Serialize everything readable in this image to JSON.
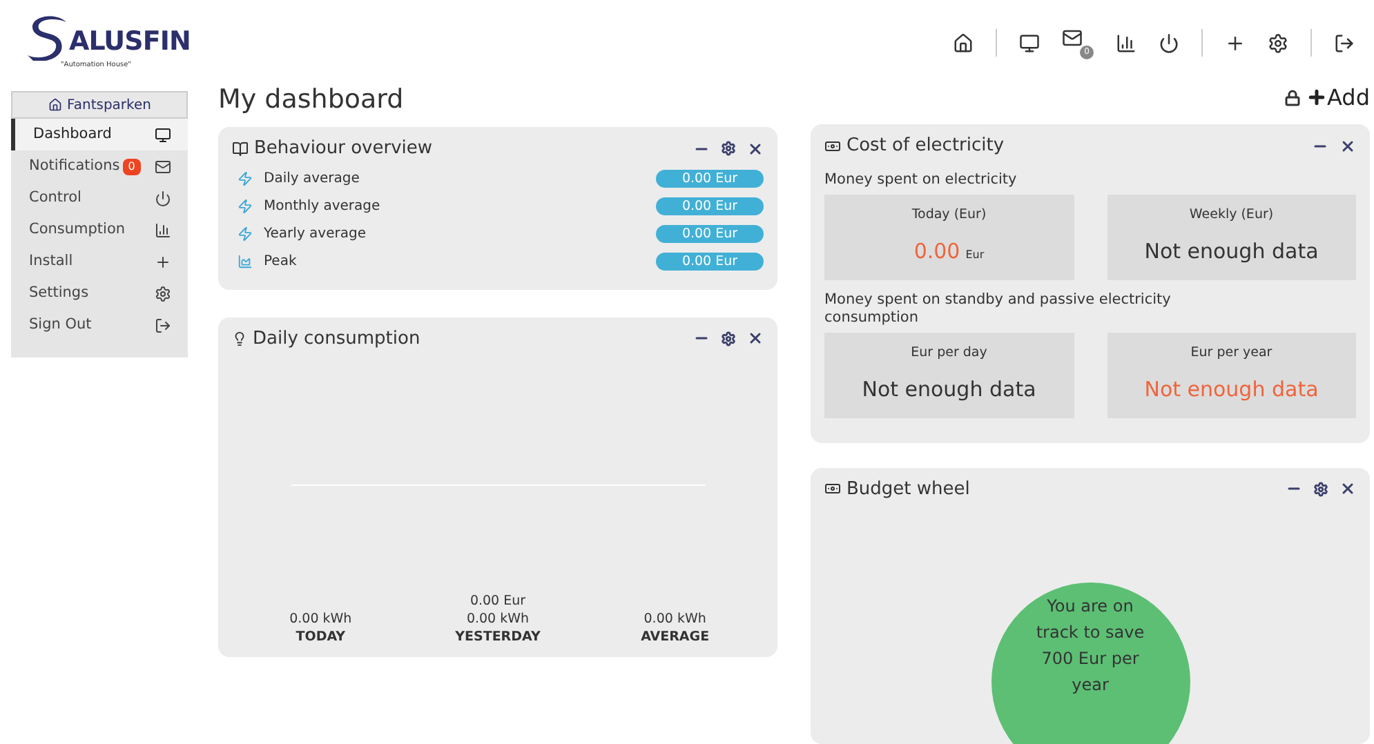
{
  "logo": {
    "letters": "ALUSFIN",
    "tagline": "\"Automation House\""
  },
  "top_nav": [
    {
      "kind": "home"
    },
    {
      "kind": "divider"
    },
    {
      "kind": "monitor"
    },
    {
      "kind": "mail",
      "badge": "0"
    },
    {
      "kind": "chart"
    },
    {
      "kind": "power"
    },
    {
      "kind": "divider"
    },
    {
      "kind": "plus"
    },
    {
      "kind": "settings"
    },
    {
      "kind": "divider"
    },
    {
      "kind": "signout"
    }
  ],
  "sidebar": {
    "location": "Fantsparken",
    "items": [
      {
        "label": "Dashboard",
        "selected": true
      },
      {
        "label": "Notifications",
        "badge": "0",
        "selected": false
      },
      {
        "label": "Control",
        "selected": false
      },
      {
        "label": "Consumption",
        "selected": false
      },
      {
        "label": "Install",
        "selected": false
      },
      {
        "label": "Settings",
        "selected": false
      },
      {
        "label": "Sign Out",
        "selected": false
      }
    ]
  },
  "page_title": "My dashboard",
  "add_button": "Add",
  "behaviour_overview": {
    "title": "Behaviour overview",
    "rows": [
      {
        "kind": "average",
        "label": "Daily average",
        "value": "0.00 Eur"
      },
      {
        "kind": "average",
        "label": "Monthly average",
        "value": "0.00 Eur"
      },
      {
        "kind": "average",
        "label": "Yearly average",
        "value": "0.00 Eur"
      },
      {
        "kind": "peak",
        "label": "Peak",
        "value": "0.00 Eur"
      }
    ]
  },
  "daily_consumption": {
    "title": "Daily consumption",
    "stats": [
      {
        "value": "0.00 kWh",
        "label": "TODAY"
      },
      {
        "extra": "0.00 Eur",
        "value": "0.00 kWh",
        "label": "YESTERDAY"
      },
      {
        "value": "0.00 kWh",
        "label": "AVERAGE"
      }
    ]
  },
  "cost_of_electricity": {
    "title": "Cost of electricity",
    "sections": [
      {
        "heading": "Money spent on electricity",
        "tiles": [
          {
            "label": "Today (Eur)",
            "value": "0.00",
            "unit": "Eur",
            "highlight": true
          },
          {
            "label": "Weekly (Eur)",
            "value": "Not enough data",
            "highlight": false
          }
        ]
      },
      {
        "heading": "Money spent on standby and passive electricity consumption",
        "tiles": [
          {
            "label": "Eur per day",
            "value": "Not enough data",
            "highlight": false
          },
          {
            "label": "Eur per year",
            "value": "Not enough data",
            "highlight": true
          }
        ]
      }
    ]
  },
  "budget_wheel": {
    "title": "Budget wheel",
    "message": "You are on track to save 700 Eur per year"
  }
}
